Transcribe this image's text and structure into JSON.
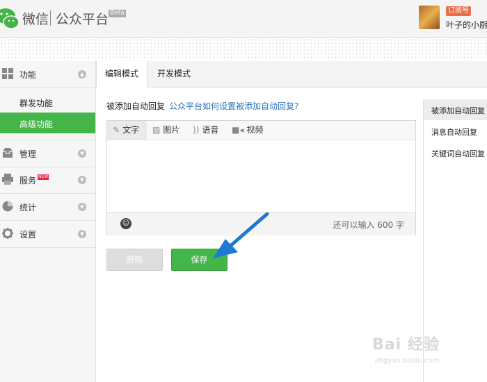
{
  "header": {
    "logo_text": "微信",
    "platform": "公众平台",
    "beta": "Beta",
    "account_type": "订阅号",
    "account_name": "叶子的小厨"
  },
  "sidebar": {
    "groups": [
      {
        "label": "功能",
        "icon": "grid-icon"
      },
      {
        "label": "管理",
        "icon": "inbox-icon"
      },
      {
        "label": "服务",
        "icon": "printer-icon",
        "badge": "NEW"
      },
      {
        "label": "统计",
        "icon": "pie-chart-icon"
      },
      {
        "label": "设置",
        "icon": "gear-icon"
      }
    ],
    "subitems": [
      {
        "label": "群发功能"
      },
      {
        "label": "高级功能",
        "active": true
      }
    ]
  },
  "tabs": [
    {
      "label": "编辑模式",
      "active": true
    },
    {
      "label": "开发模式"
    }
  ],
  "main": {
    "question": "被添加自动回复",
    "help_link": "公众平台如何设置被添加自动回复?"
  },
  "editor": {
    "tabs": [
      {
        "label": "文字",
        "icon": "pencil-icon"
      },
      {
        "label": "图片",
        "icon": "image-icon"
      },
      {
        "label": "语音",
        "icon": "sound-icon"
      },
      {
        "label": "视频",
        "icon": "video-icon"
      }
    ],
    "counter": "还可以输入 600 字"
  },
  "buttons": {
    "delete": "删除",
    "save": "保存"
  },
  "right_panel": {
    "items": [
      {
        "label": "被添加自动回复",
        "active": true
      },
      {
        "label": "消息自动回复"
      },
      {
        "label": "关键词自动回复"
      }
    ]
  },
  "watermark": {
    "line1": "Bai 经验",
    "line2": "jingyan.baidu.com"
  },
  "colors": {
    "accent_green": "#44b549",
    "link_blue": "#2a74b8",
    "arrow_blue": "#1f78d1"
  }
}
